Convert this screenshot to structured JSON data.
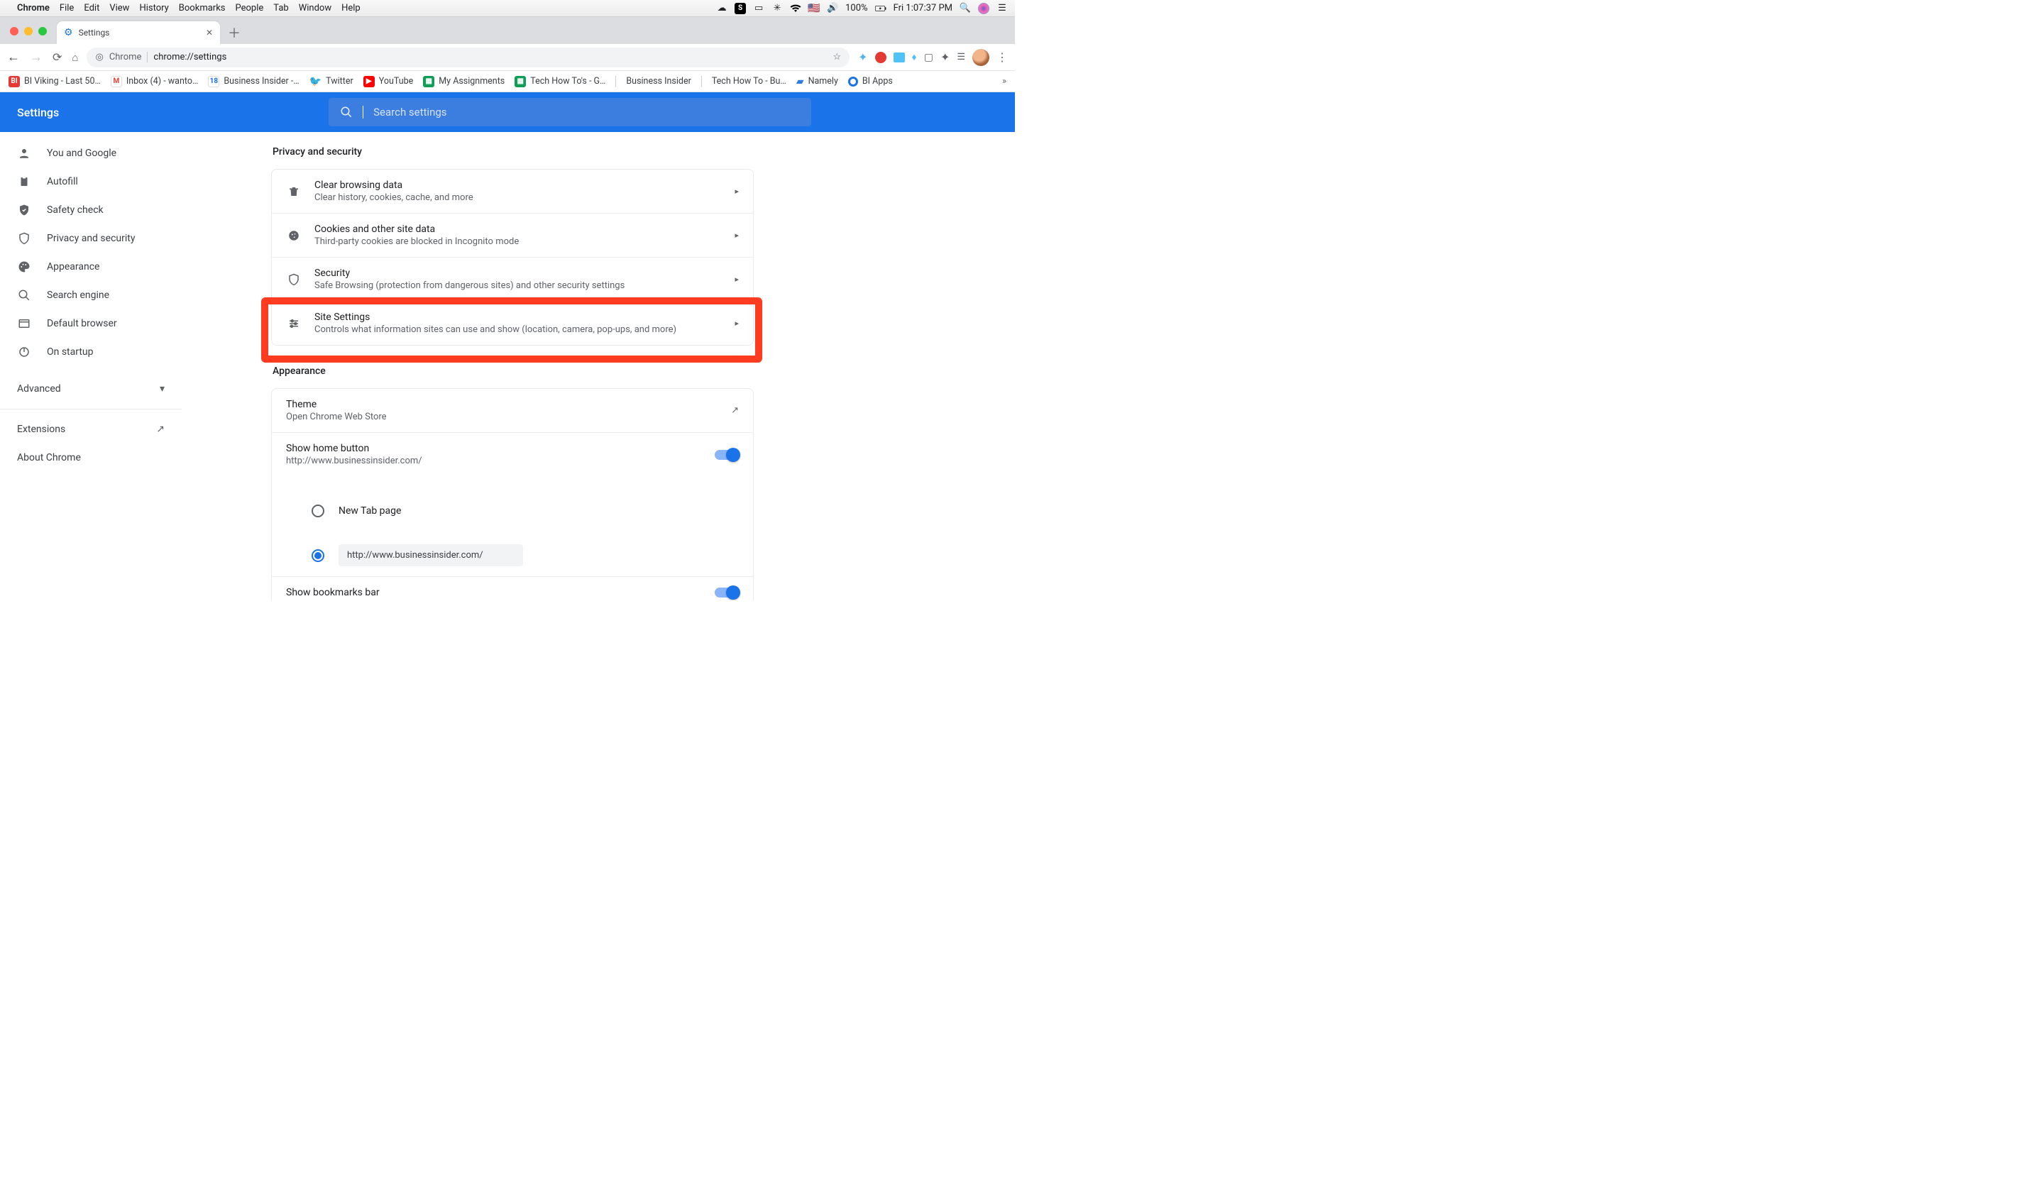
{
  "menubar": {
    "app": "Chrome",
    "items": [
      "File",
      "Edit",
      "View",
      "History",
      "Bookmarks",
      "People",
      "Tab",
      "Window",
      "Help"
    ],
    "battery": "100%",
    "clock": "Fri 1:07:37 PM"
  },
  "tab": {
    "title": "Settings"
  },
  "omnibox": {
    "chrome_label": "Chrome",
    "url": "chrome://settings"
  },
  "bookmarks": [
    {
      "icon": "bi",
      "label": "BI Viking - Last 50…"
    },
    {
      "icon": "gmail",
      "label": "Inbox (4) - wanto…"
    },
    {
      "icon": "cal",
      "label": "Business Insider -…"
    },
    {
      "icon": "twitter",
      "label": "Twitter"
    },
    {
      "icon": "yt",
      "label": "YouTube"
    },
    {
      "icon": "sheets",
      "label": "My Assignments"
    },
    {
      "icon": "sheets",
      "label": "Tech How To's - G…"
    },
    {
      "icon": "sep",
      "label": ""
    },
    {
      "icon": "none",
      "label": "Business Insider"
    },
    {
      "icon": "sep",
      "label": ""
    },
    {
      "icon": "none",
      "label": "Tech How To - Bu…"
    },
    {
      "icon": "namely",
      "label": "Namely"
    },
    {
      "icon": "biapps",
      "label": "BI Apps"
    }
  ],
  "settings": {
    "title": "Settings",
    "search_placeholder": "Search settings"
  },
  "sidebar": {
    "items": [
      {
        "icon": "person",
        "label": "You and Google"
      },
      {
        "icon": "clipboard",
        "label": "Autofill"
      },
      {
        "icon": "check-shield",
        "label": "Safety check"
      },
      {
        "icon": "shield",
        "label": "Privacy and security"
      },
      {
        "icon": "palette",
        "label": "Appearance"
      },
      {
        "icon": "search",
        "label": "Search engine"
      },
      {
        "icon": "window",
        "label": "Default browser"
      },
      {
        "icon": "power",
        "label": "On startup"
      }
    ],
    "advanced": "Advanced",
    "extensions": "Extensions",
    "about": "About Chrome"
  },
  "sections": {
    "privacy_title": "Privacy and security",
    "privacy_rows": [
      {
        "icon": "trash",
        "title": "Clear browsing data",
        "sub": "Clear history, cookies, cache, and more"
      },
      {
        "icon": "cookie",
        "title": "Cookies and other site data",
        "sub": "Third-party cookies are blocked in Incognito mode"
      },
      {
        "icon": "shield",
        "title": "Security",
        "sub": "Safe Browsing (protection from dangerous sites) and other security settings"
      },
      {
        "icon": "sliders",
        "title": "Site Settings",
        "sub": "Controls what information sites can use and show (location, camera, pop-ups, and more)"
      }
    ],
    "appearance_title": "Appearance",
    "theme": {
      "title": "Theme",
      "sub": "Open Chrome Web Store"
    },
    "home": {
      "title": "Show home button",
      "sub": "http://www.businessinsider.com/"
    },
    "newtab_label": "New Tab page",
    "custom_url": "http://www.businessinsider.com/",
    "bookmarks_bar": {
      "title": "Show bookmarks bar"
    }
  }
}
